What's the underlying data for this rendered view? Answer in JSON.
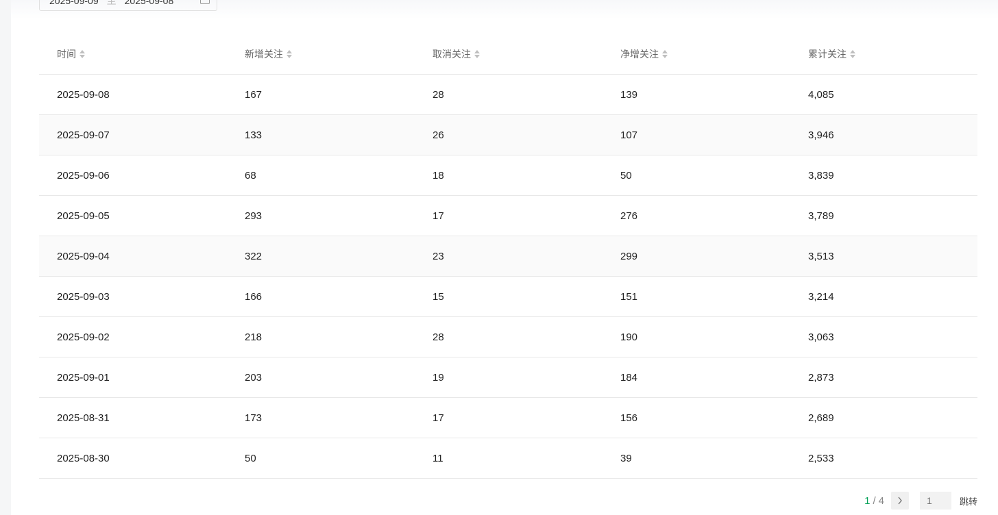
{
  "filter": {
    "date_start": "2025-09-09",
    "date_sep": "至",
    "date_end": "2025-09-08"
  },
  "table": {
    "columns": [
      "时间",
      "新增关注",
      "取消关注",
      "净增关注",
      "累计关注"
    ],
    "rows": [
      [
        "2025-09-08",
        "167",
        "28",
        "139",
        "4,085"
      ],
      [
        "2025-09-07",
        "133",
        "26",
        "107",
        "3,946"
      ],
      [
        "2025-09-06",
        "68",
        "18",
        "50",
        "3,839"
      ],
      [
        "2025-09-05",
        "293",
        "17",
        "276",
        "3,789"
      ],
      [
        "2025-09-04",
        "322",
        "23",
        "299",
        "3,513"
      ],
      [
        "2025-09-03",
        "166",
        "15",
        "151",
        "3,214"
      ],
      [
        "2025-09-02",
        "218",
        "28",
        "190",
        "3,063"
      ],
      [
        "2025-09-01",
        "203",
        "19",
        "184",
        "2,873"
      ],
      [
        "2025-08-31",
        "173",
        "17",
        "156",
        "2,689"
      ],
      [
        "2025-08-30",
        "50",
        "11",
        "39",
        "2,533"
      ]
    ]
  },
  "pagination": {
    "current": "1",
    "separator": "/",
    "total": "4",
    "input_placeholder": "1",
    "jump_label": "跳转"
  },
  "colors": {
    "accent": "#07a35a",
    "border": "#e8e8e8",
    "header_text": "#666666"
  }
}
